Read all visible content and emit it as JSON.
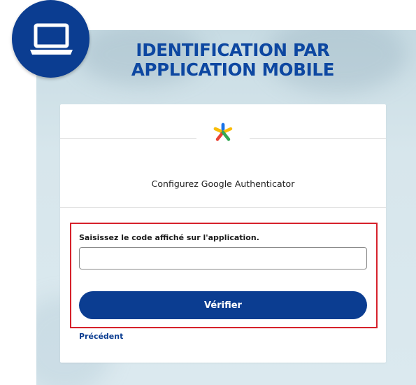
{
  "header": {
    "title_line1": "IDENTIFICATION PAR",
    "title_line2": "APPLICATION MOBILE",
    "badge_icon": "laptop-icon"
  },
  "card": {
    "logo_icon": "google-authenticator-icon",
    "title": "Configurez Google Authenticator"
  },
  "form": {
    "code_label": "Saisissez le code affiché sur l'application.",
    "code_value": "",
    "code_placeholder": "",
    "verify_label": "Vérifier",
    "back_link": "Précédent"
  },
  "colors": {
    "brand_blue": "#0b3d91",
    "highlight_red": "#d6212b",
    "background_tint": "#d3e3ea"
  }
}
